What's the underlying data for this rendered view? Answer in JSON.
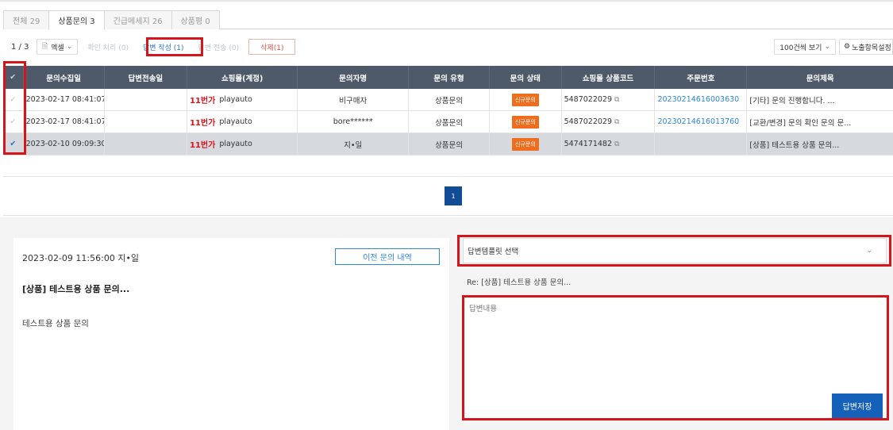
{
  "tabs": [
    {
      "label": "전체 29"
    },
    {
      "label": "상품문의 3"
    },
    {
      "label": "긴급메세지 26"
    },
    {
      "label": "상품평 0"
    }
  ],
  "toolbar": {
    "page": "1 / 3",
    "excel": "엑셀",
    "confirm": "확인 처리 (0)",
    "write_answer": "답변 작성 (1)",
    "edit_answer": "답변 전송 (0)",
    "delete": "삭제(1)",
    "per_page": "100건씩 보기",
    "column_settings": "노출항목설정"
  },
  "grid": {
    "headers": [
      "문의수집일",
      "답변전송일",
      "쇼핑몰(계정)",
      "문의자명",
      "문의 유형",
      "문의 상태",
      "쇼핑몰 상품코드",
      "주문번호",
      "문의제목"
    ],
    "rows": [
      {
        "collected": "2023-02-17 08:41:07",
        "sent": "",
        "mall_logo": "11번가",
        "account": "playauto",
        "name": "비구매자",
        "type": "상품문의",
        "status": "신규문의",
        "code": "5487022029",
        "order": "20230214616003630",
        "title": "[기타] 문의 진행합니다. ...",
        "checked": false
      },
      {
        "collected": "2023-02-17 08:41:07",
        "sent": "",
        "mall_logo": "11번가",
        "account": "playauto",
        "name": "bore******",
        "type": "상품문의",
        "status": "신규문의",
        "code": "5487022029",
        "order": "20230214616013760",
        "title": "[교환/변경] 문의 확인 문의 문...",
        "checked": false
      },
      {
        "collected": "2023-02-10 09:09:30",
        "sent": "",
        "mall_logo": "11번가",
        "account": "playauto",
        "name": "지•일",
        "type": "상품문의",
        "status": "신규문의",
        "code": "5474171482",
        "order": "",
        "title": "[상품] 테스트용 상품 문의...",
        "checked": true
      }
    ],
    "page_number": "1"
  },
  "detail": {
    "date_author": "2023-02-09 11:56:00 지•일",
    "prev_button": "이전 문의 내역",
    "title": "[상품] 테스트용 상품 문의...",
    "body": "테스트용 상품 문의"
  },
  "reply": {
    "template_select": "답변템플릿 선택",
    "re_title": "Re: [상품] 테스트용 상품 문의...",
    "placeholder": "답변내용",
    "save": "답변저장"
  },
  "colors": {
    "header_bg": "#4e5a69",
    "accent_blue": "#1560b8",
    "badge_orange": "#ef6d1e",
    "highlight_red": "#d4161c"
  }
}
